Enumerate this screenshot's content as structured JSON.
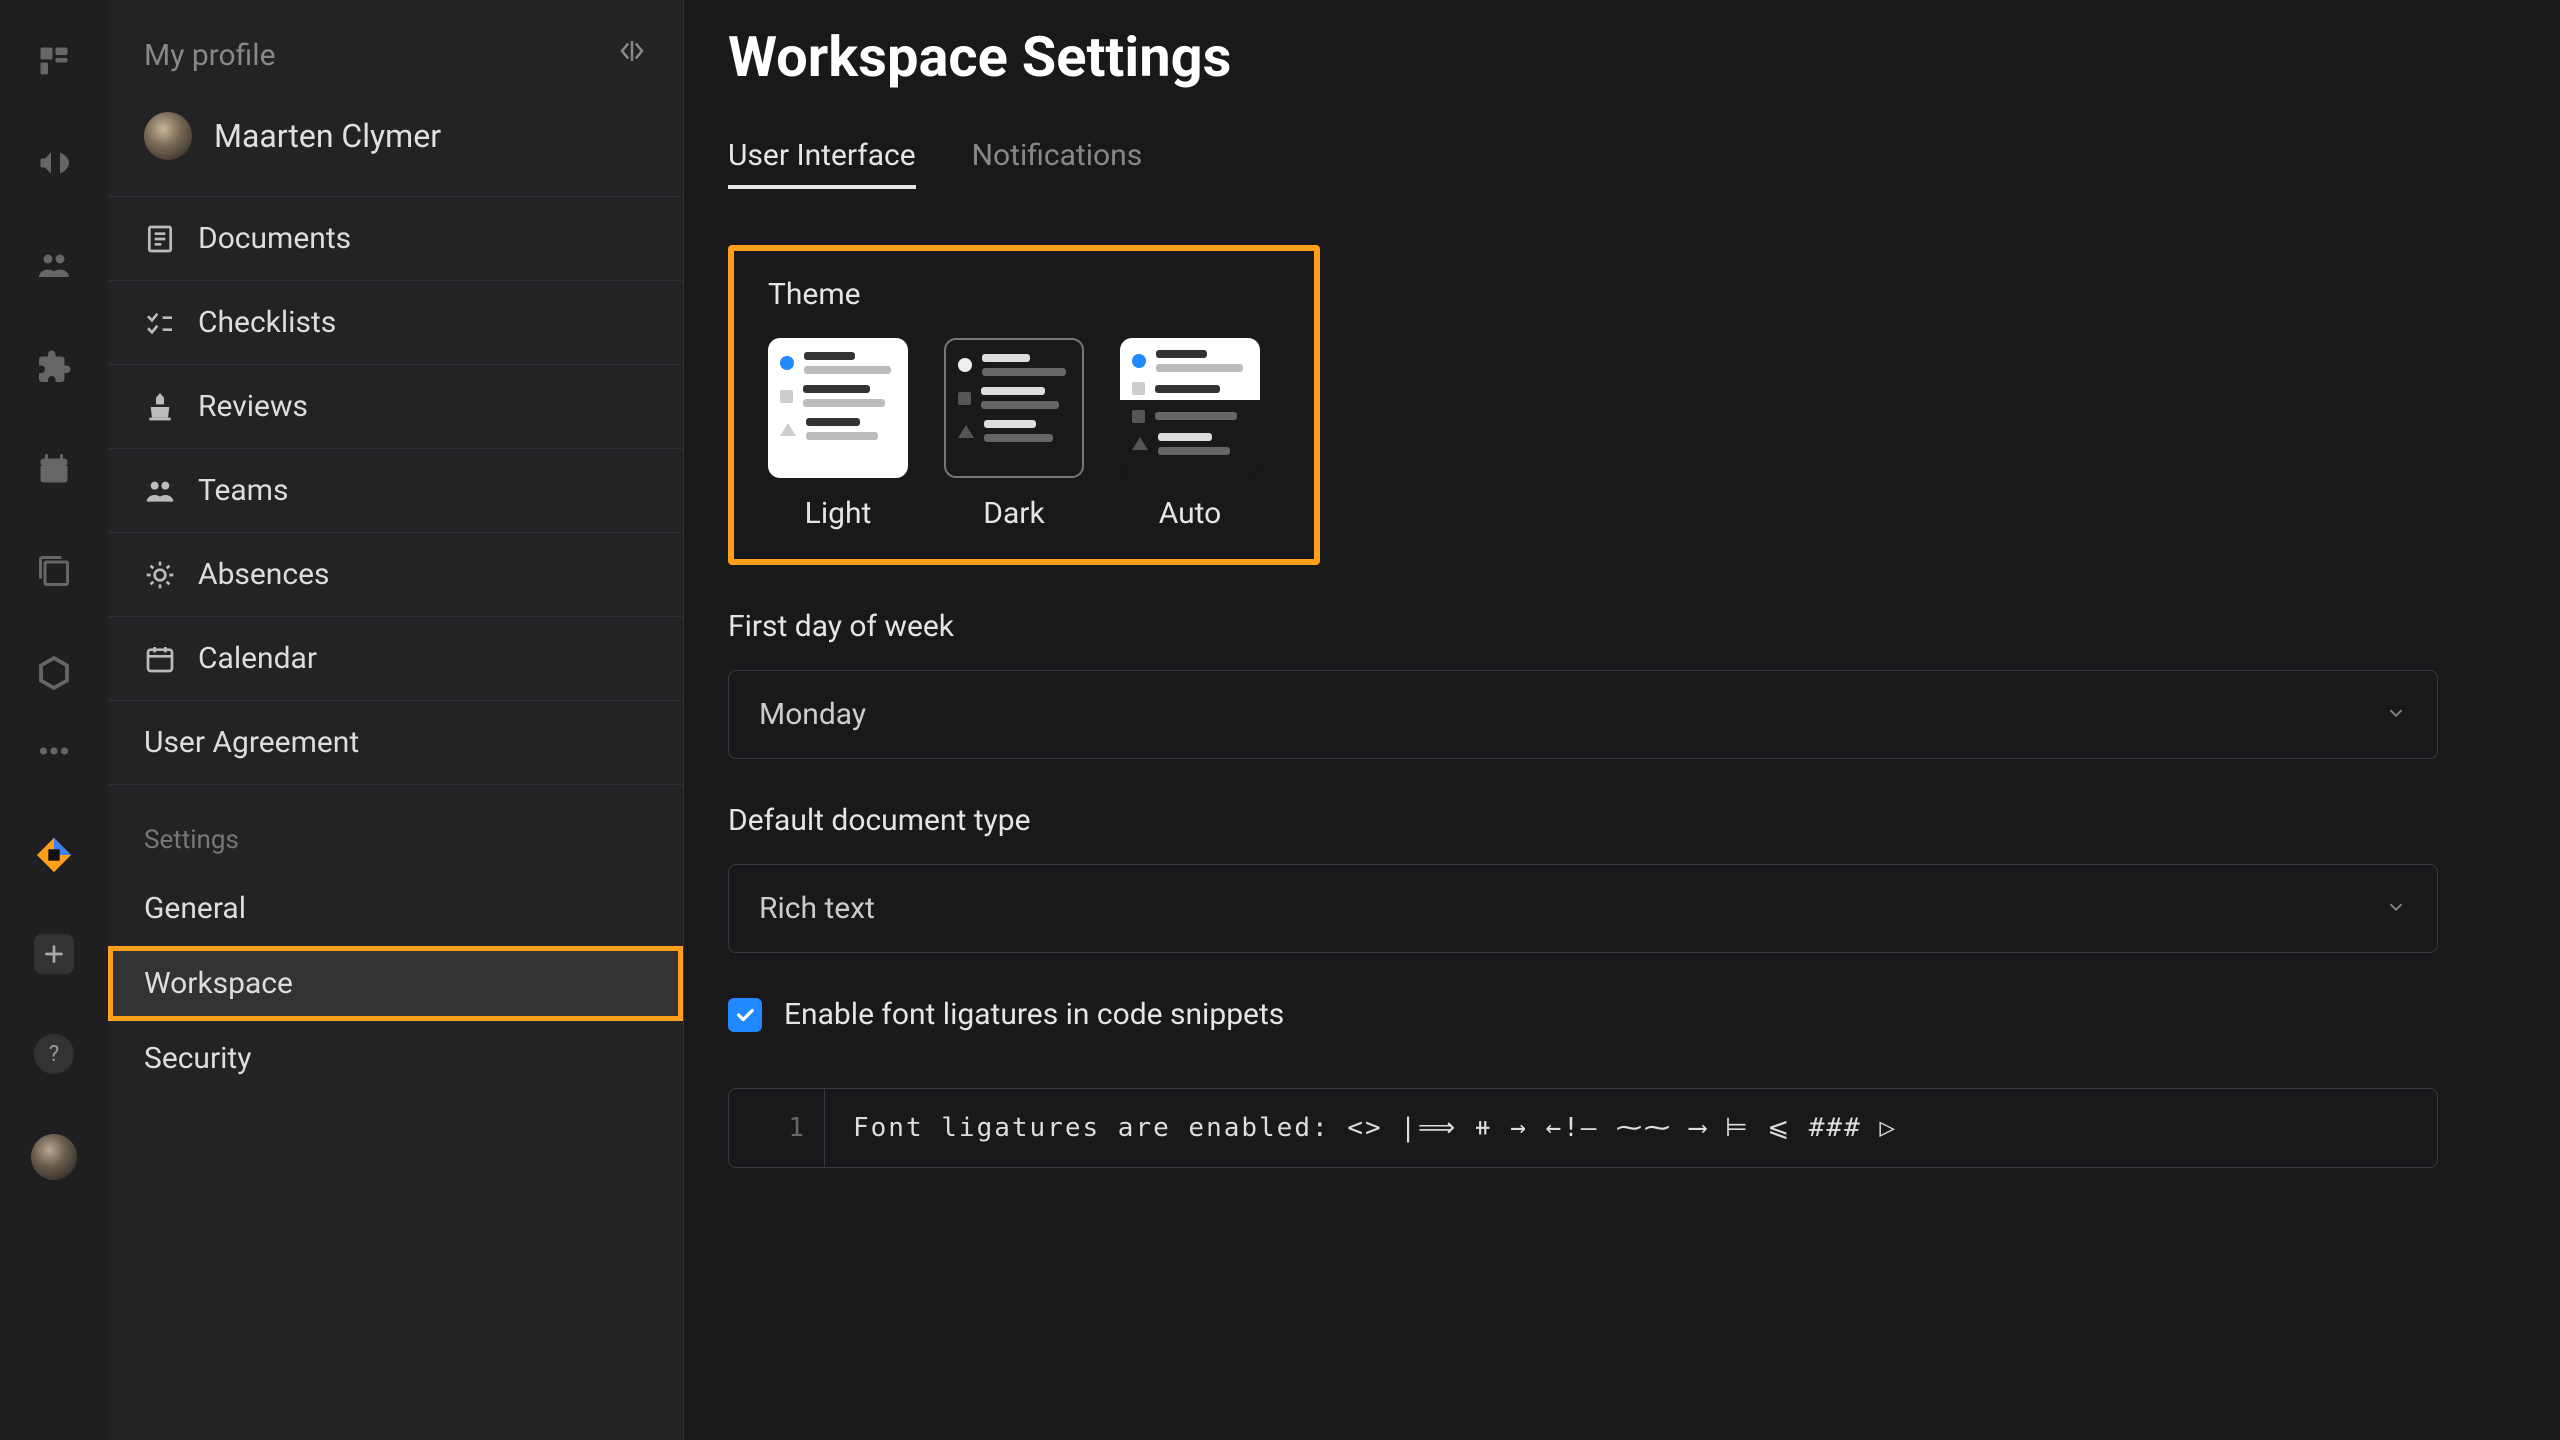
{
  "rail": {
    "icons": [
      "dashboard",
      "announce",
      "teams",
      "extension",
      "calendar",
      "collections",
      "settings-hex",
      "more"
    ]
  },
  "sidebar": {
    "section_title": "My profile",
    "profile_name": "Maarten Clymer",
    "items": [
      {
        "icon": "document",
        "label": "Documents"
      },
      {
        "icon": "checklist",
        "label": "Checklists"
      },
      {
        "icon": "review",
        "label": "Reviews"
      },
      {
        "icon": "teams",
        "label": "Teams"
      },
      {
        "icon": "sun",
        "label": "Absences"
      },
      {
        "icon": "calendar",
        "label": "Calendar"
      }
    ],
    "user_agreement": "User Agreement",
    "settings_label": "Settings",
    "settings": [
      {
        "label": "General",
        "active": false
      },
      {
        "label": "Workspace",
        "active": true
      },
      {
        "label": "Security",
        "active": false
      }
    ]
  },
  "page": {
    "title": "Workspace Settings",
    "tabs": [
      {
        "label": "User Interface",
        "active": true
      },
      {
        "label": "Notifications",
        "active": false
      }
    ],
    "theme": {
      "label": "Theme",
      "options": [
        "Light",
        "Dark",
        "Auto"
      ],
      "selected": "Dark"
    },
    "first_day": {
      "label": "First day of week",
      "value": "Monday"
    },
    "doc_type": {
      "label": "Default document type",
      "value": "Rich text"
    },
    "ligatures_checkbox": {
      "checked": true,
      "label": "Enable font ligatures in code snippets"
    },
    "code_sample": {
      "line_number": "1",
      "text": "Font ligatures are enabled: <> |⟹ ⧺ → ←!— ⁓⁓ ⟶ ⊨ ⩽ ### ▷"
    }
  }
}
